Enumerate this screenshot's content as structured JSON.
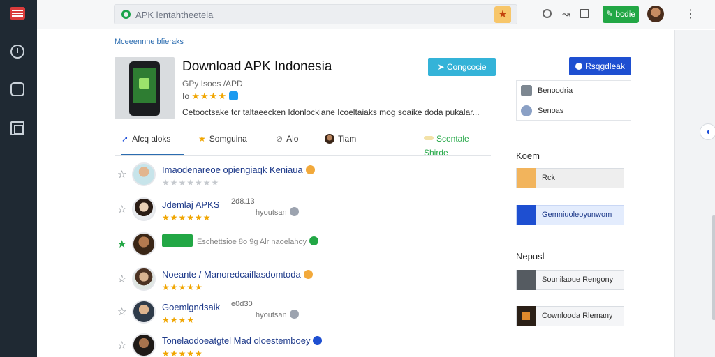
{
  "search": {
    "value": "APK lentahtheeteia"
  },
  "toolbar": {
    "primary_button": "bcdie"
  },
  "page": {
    "breadcrumb": "Mceeennne bfieraks",
    "app_title": "Download APK Indonesia",
    "app_subtitle": "GPy Isoes /APD",
    "app_rating_prefix": "Io",
    "app_description": "Cetooctsake tcr taltaeecken Idonlockiane Icoeltaiaks mog soaike doda pukalar...",
    "primary_cta": "Congcocie",
    "secondary_cta": "Rsqgdleak"
  },
  "tabs": [
    {
      "label": "Afcq aloks"
    },
    {
      "label": "Somguina"
    },
    {
      "label": "Alo"
    },
    {
      "label": "Tiam"
    }
  ],
  "tabs_right": "Scentale Shirde",
  "reviews": [
    {
      "name": "Imaodenareoe opiengiaqk Keniaua",
      "stars": "★★★★★★★",
      "side": "",
      "version": "",
      "verified": "orange",
      "rating_style": "grey"
    },
    {
      "name": "Jdemlaj APKS",
      "stars": "★★★★★★",
      "side": "hyoutsan",
      "version": "2d8.13",
      "verified": "grey",
      "rating_style": "gold"
    },
    {
      "name": "Eschettsioe 8o 9g Alr naoelahoy",
      "stars": "",
      "side": "",
      "version": "",
      "verified": "green",
      "rating_style": "pill"
    },
    {
      "name": "Noeante / Manoredcaiflasdomtoda",
      "stars": "★★★★★",
      "side": "",
      "version": "",
      "verified": "orange",
      "rating_style": "gold"
    },
    {
      "name": "Goemlgndsaik",
      "stars": "★★★★",
      "side": "hyoutsan",
      "version": "e0d30",
      "verified": "grey",
      "rating_style": "gold"
    },
    {
      "name": "Tonelaodoeatgtel Mad oloestemboey",
      "stars": "★★★★★",
      "side": "",
      "version": "",
      "verified": "blue",
      "rating_style": "gold"
    }
  ],
  "side_panel": {
    "mini_items": [
      "Benoodria",
      "Senoas"
    ],
    "section1_title": "Koem",
    "section1_buttons": [
      "Rck",
      "Gemniuoleoyunwom"
    ],
    "section2_title": "Nepusl",
    "section2_buttons": [
      "Sounilaoue Rengony",
      "Cownlooda Rlemany"
    ]
  },
  "colors": {
    "accent": "#1e4fd1",
    "brand_green": "#22a745",
    "cyan": "#34b3d8",
    "rail": "#1f2933",
    "star": "#f0a500"
  }
}
